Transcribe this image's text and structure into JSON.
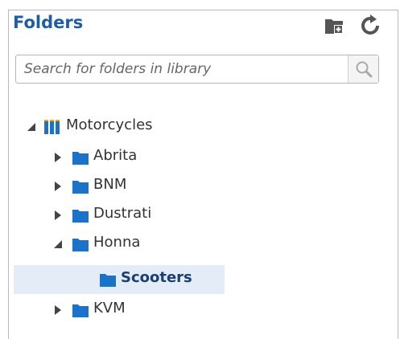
{
  "panel": {
    "title": "Folders",
    "toolbar": {
      "new_folder_icon": "new-folder-icon",
      "refresh_icon": "refresh-icon"
    },
    "search": {
      "placeholder": "Search for folders in library",
      "value": ""
    },
    "tree": {
      "root": {
        "label": "Motorcycles",
        "expanded": true,
        "icon": "library-icon"
      },
      "children": [
        {
          "label": "Abrita",
          "expanded": false,
          "icon": "folder-icon"
        },
        {
          "label": "BNM",
          "expanded": false,
          "icon": "folder-icon"
        },
        {
          "label": "Dustrati",
          "expanded": false,
          "icon": "folder-icon"
        },
        {
          "label": "Honna",
          "expanded": true,
          "icon": "folder-icon",
          "children": [
            {
              "label": "Scooters",
              "selected": true,
              "icon": "folder-icon"
            }
          ]
        },
        {
          "label": "KVM",
          "expanded": false,
          "icon": "folder-icon"
        }
      ]
    }
  },
  "colors": {
    "accent": "#1f5da3",
    "folder_blue": "#1a73c9",
    "selected_bg": "#e3ecf7"
  }
}
